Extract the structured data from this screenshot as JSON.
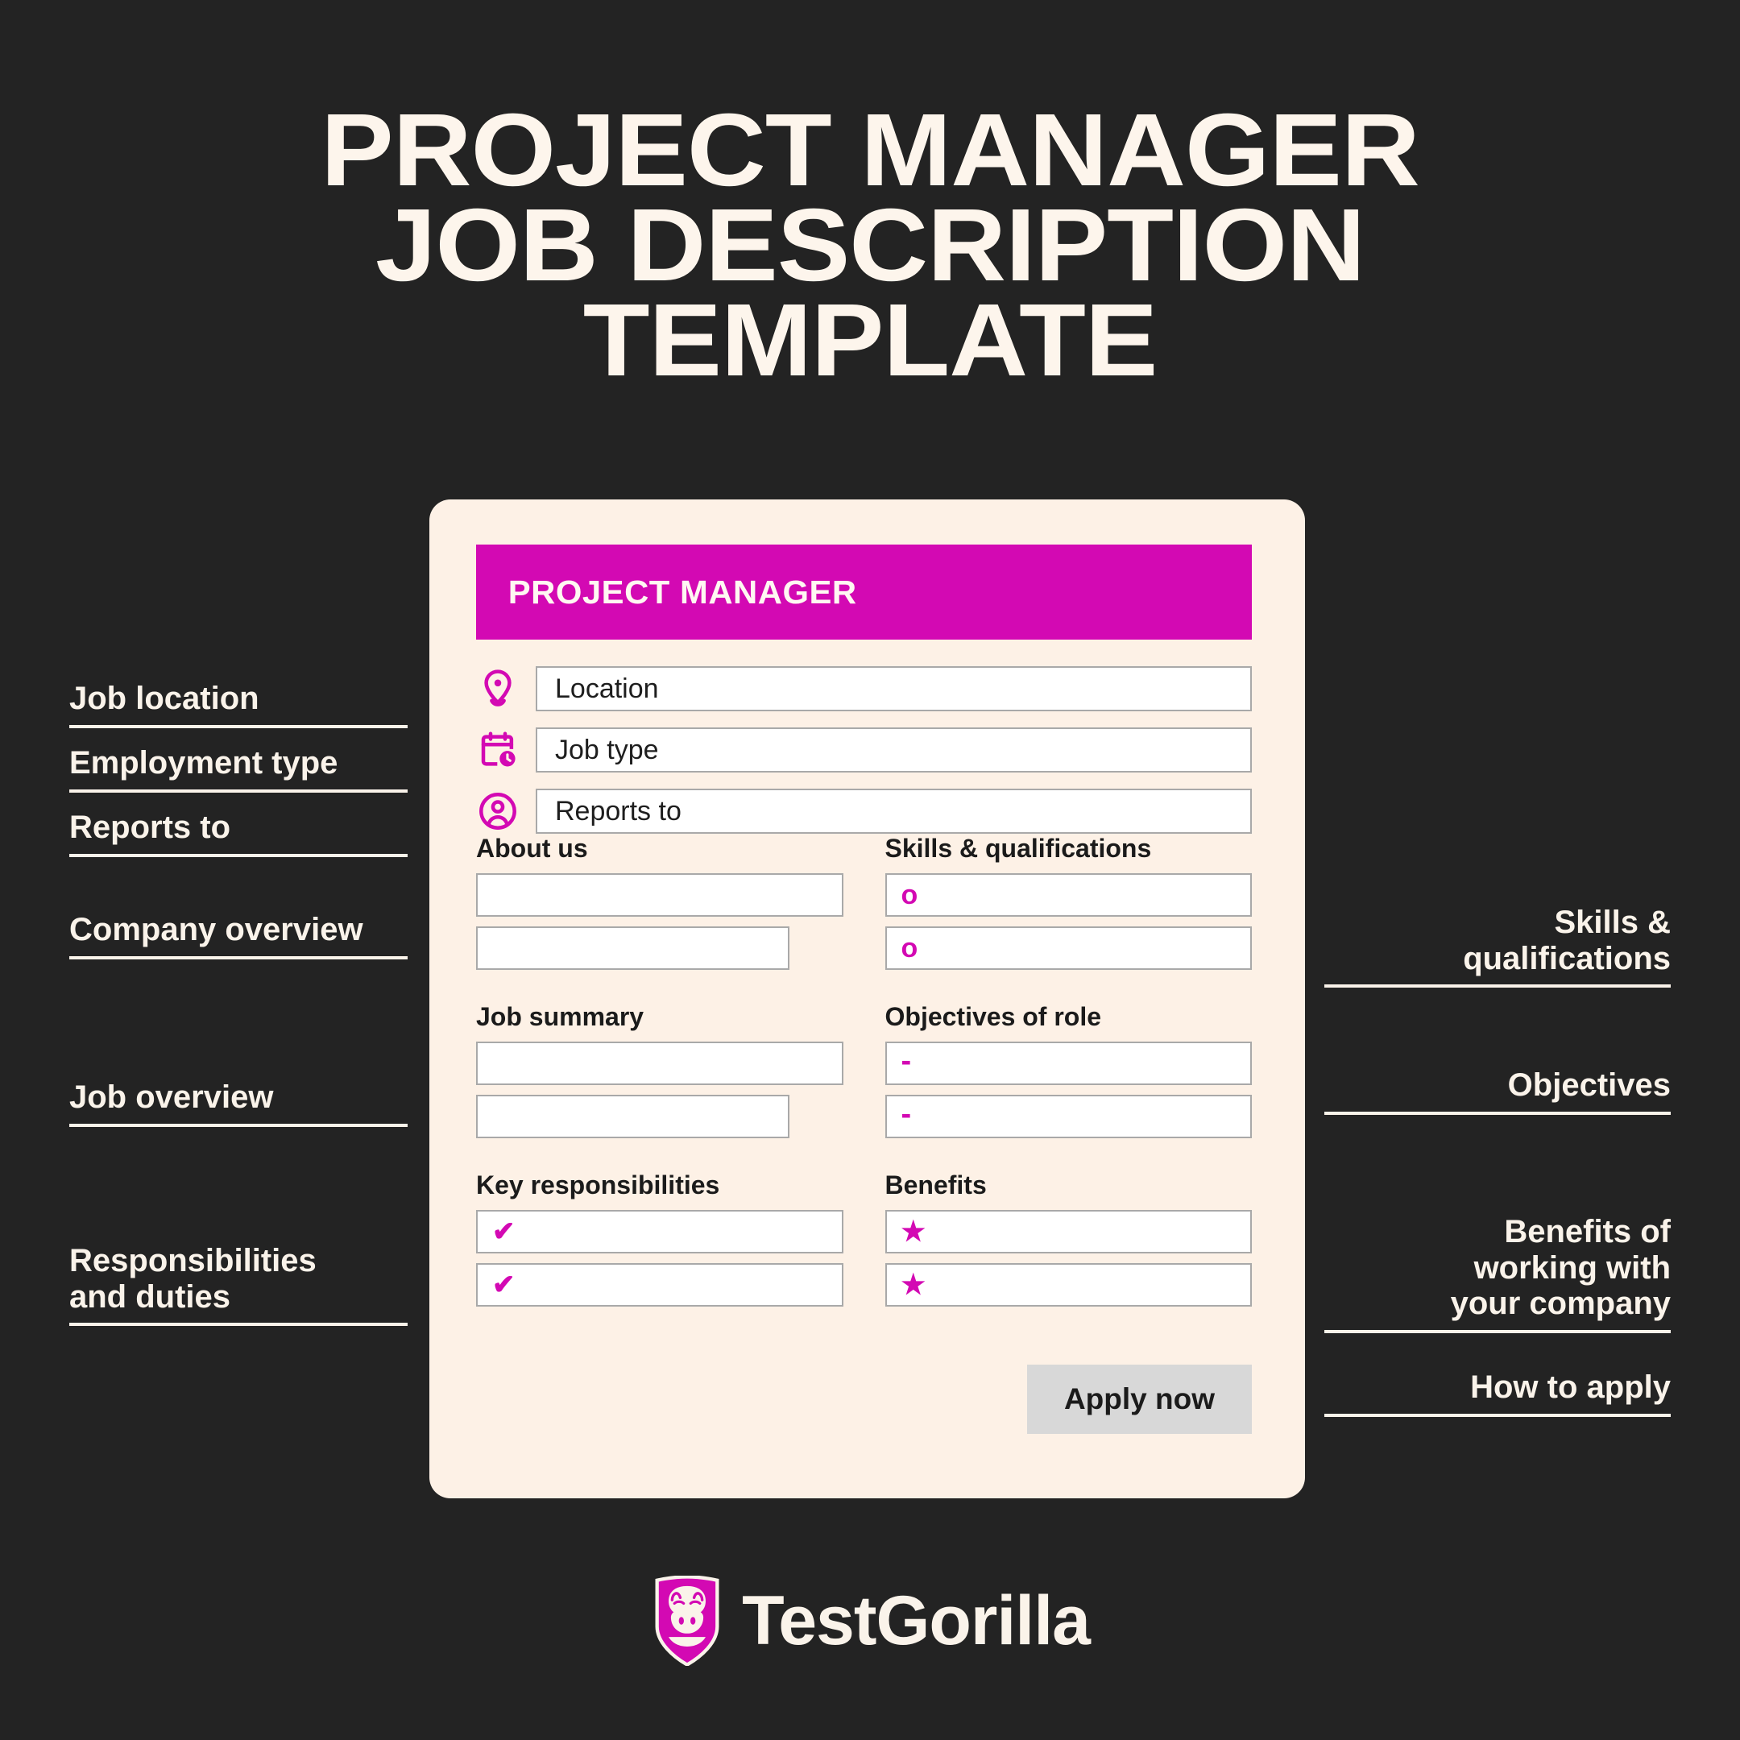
{
  "colors": {
    "background": "#232323",
    "card": "#FDF1E6",
    "accent_magenta": "#D309B3",
    "cream_text": "#FAF3EA",
    "button_grey": "#D8D8D8",
    "field_border": "#A9A9A9"
  },
  "title": {
    "line1": "PROJECT MANAGER",
    "line2": "JOB DESCRIPTION",
    "line3": "TEMPLATE"
  },
  "card": {
    "header": "PROJECT MANAGER",
    "info_rows": [
      {
        "icon": "location-pin-icon",
        "label": "Location"
      },
      {
        "icon": "calendar-clock-icon",
        "label": "Job type"
      },
      {
        "icon": "user-circle-icon",
        "label": "Reports to"
      }
    ],
    "groups": [
      {
        "label": "About us",
        "marker": "",
        "marker_type": "none"
      },
      {
        "label": "Skills & qualifications",
        "marker": "o",
        "marker_type": "ring"
      },
      {
        "label": "Job summary",
        "marker": "",
        "marker_type": "none"
      },
      {
        "label": "Objectives of role",
        "marker": "-",
        "marker_type": "dash"
      },
      {
        "label": "Key responsibilities",
        "marker": "✔",
        "marker_type": "check"
      },
      {
        "label": "Benefits",
        "marker": "★",
        "marker_type": "star"
      }
    ],
    "apply_button": "Apply now"
  },
  "annotations_left": [
    {
      "text": "Job location"
    },
    {
      "text": "Employment type"
    },
    {
      "text": "Reports to"
    },
    {
      "text": "Company overview"
    },
    {
      "text": "Job overview"
    },
    {
      "text": "Responsibilities\nand duties"
    }
  ],
  "annotations_right": [
    {
      "text": "Skills &\nqualifications"
    },
    {
      "text": "Objectives"
    },
    {
      "text": "Benefits of\nworking with\nyour company"
    },
    {
      "text": "How to apply"
    }
  ],
  "footer": {
    "logo_text": "TestGorilla",
    "logo_mark": "gorilla-shield-icon"
  }
}
